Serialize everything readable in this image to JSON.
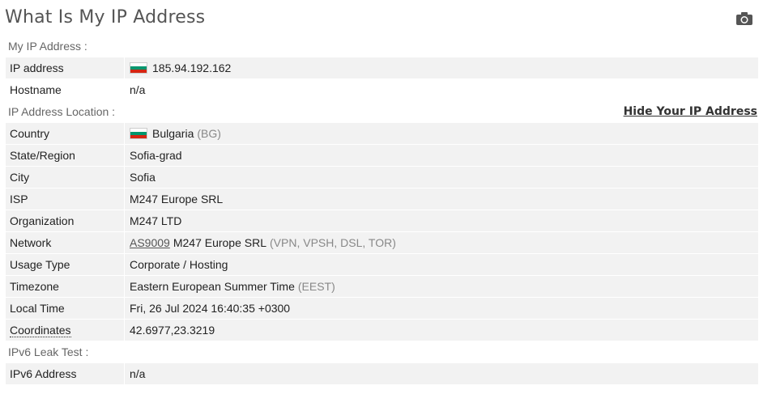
{
  "page": {
    "title": "What Is My IP Address"
  },
  "colors": {
    "flag_white": "#ffffff",
    "flag_green": "#00966e",
    "flag_red": "#d62612",
    "row_shade": "#f2f2f2"
  },
  "my_ip": {
    "section_label": "My IP Address :",
    "rows": [
      {
        "label": "IP address",
        "value": "185.94.192.162",
        "flag": "bg"
      },
      {
        "label": "Hostname",
        "value": "n/a"
      }
    ]
  },
  "location": {
    "section_label": "IP Address Location :",
    "hide_link": "Hide Your IP Address",
    "country": {
      "label": "Country",
      "value": "Bulgaria",
      "code": "(BG)"
    },
    "state": {
      "label": "State/Region",
      "value": "Sofia-grad"
    },
    "city": {
      "label": "City",
      "value": "Sofia"
    },
    "isp": {
      "label": "ISP",
      "value": "M247 Europe SRL"
    },
    "org": {
      "label": "Organization",
      "value": "M247 LTD"
    },
    "network": {
      "label": "Network",
      "as_link": "AS9009",
      "value": "M247 Europe SRL",
      "extra": "(VPN, VPSH, DSL, TOR)"
    },
    "usage": {
      "label": "Usage Type",
      "value": "Corporate / Hosting"
    },
    "timezone": {
      "label": "Timezone",
      "value": "Eastern European Summer Time",
      "abbr": "(EEST)"
    },
    "local_time": {
      "label": "Local Time",
      "value": "Fri, 26 Jul 2024 16:40:35 +0300"
    },
    "coords": {
      "label": "Coordinates",
      "value": "42.6977,23.3219"
    }
  },
  "ipv6": {
    "section_label": "IPv6 Leak Test :",
    "row": {
      "label": "IPv6 Address",
      "value": "n/a"
    }
  },
  "icons": {
    "camera": "camera-icon",
    "flag": "bulgaria-flag-icon"
  }
}
